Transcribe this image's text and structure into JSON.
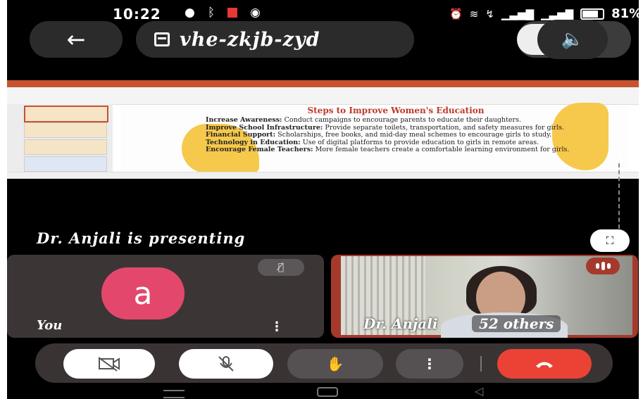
{
  "status_bar": {
    "time": "10:22",
    "battery_percent": "81%",
    "left_icons": [
      "message-icon",
      "bluetooth-icon",
      "record-icon",
      "whatsapp-icon"
    ],
    "right_icons": [
      "alarm-icon",
      "wifi-icon",
      "volte-icon",
      "signal-icon",
      "signal-icon"
    ]
  },
  "top_bar": {
    "back_icon": "←",
    "meeting_code": "vhe-zkjb-zyd",
    "audio_icon": "speaker-icon"
  },
  "shared_screen": {
    "slide_title": "Steps to Improve Women's Education",
    "bullets": [
      {
        "label": "Increase Awareness:",
        "text": " Conduct campaigns to encourage parents to educate their daughters."
      },
      {
        "label": "Improve School Infrastructure:",
        "text": " Provide separate toilets, transportation, and safety measures for girls."
      },
      {
        "label": "Financial Support:",
        "text": " Scholarships, free books, and mid-day meal schemes to encourage girls to study."
      },
      {
        "label": "Technology in Education:",
        "text": " Use of digital platforms to provide education to girls in remote areas."
      },
      {
        "label": "Encourage Female Teachers:",
        "text": " More female teachers create a comfortable learning environment for girls."
      }
    ]
  },
  "presenting_label": "Dr. Anjali is presenting",
  "tiles": {
    "you": {
      "avatar_letter": "a",
      "label": "You",
      "menu": "⋮"
    },
    "presenter": {
      "name_label": "Dr. Anjali",
      "others_label": "52 others"
    }
  },
  "controls": {
    "camera": "camera-off-icon",
    "mic": "mic-off-icon",
    "hand": "raise-hand-icon",
    "more": "⋮",
    "end": "end-call-icon"
  },
  "colors": {
    "avatar": "#e3486c",
    "end_call": "#ea4335",
    "presenter_border": "#a53a2c",
    "slide_title": "#c0392b",
    "slide_accent": "#f6c94c"
  }
}
